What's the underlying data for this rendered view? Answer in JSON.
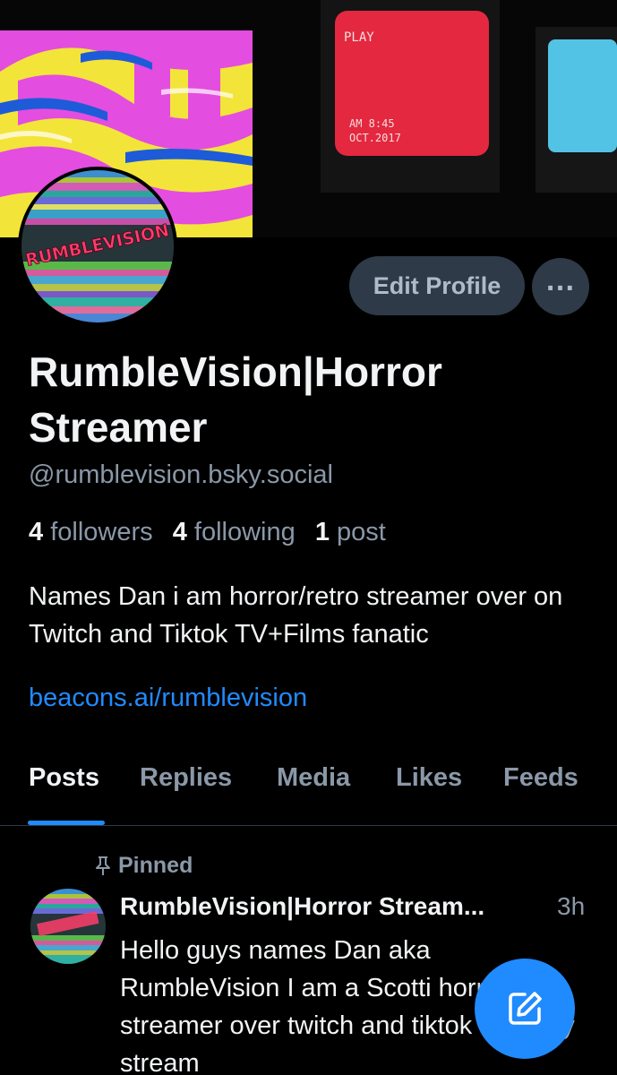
{
  "colors": {
    "background": "#000000",
    "accent": "#208bfe",
    "muted_text": "#8a98a8",
    "button_bg": "#2e3a47"
  },
  "banner": {
    "tv_overlay_top": "PLAY",
    "tv_overlay_bottom_1": "AM 8:45",
    "tv_overlay_bottom_2": "OCT.2017"
  },
  "avatar": {
    "logo_text": "RUMBLEVISION"
  },
  "actions": {
    "edit_profile_label": "Edit Profile",
    "more_icon": "more-horizontal-icon"
  },
  "profile": {
    "display_name": "RumbleVision|Horror Streamer",
    "handle": "@rumblevision.bsky.social",
    "followers_count": "4",
    "followers_label": "followers",
    "following_count": "4",
    "following_label": "following",
    "posts_count": "1",
    "posts_label": "post",
    "bio": "Names Dan i am horror/retro streamer over on Twitch and Tiktok TV+Films fanatic",
    "bio_link": "beacons.ai/rumblevision"
  },
  "tabs": [
    {
      "label": "Posts",
      "active": true
    },
    {
      "label": "Replies",
      "active": false
    },
    {
      "label": "Media",
      "active": false
    },
    {
      "label": "Likes",
      "active": false
    },
    {
      "label": "Feeds",
      "active": false
    }
  ],
  "post": {
    "pinned_label": "Pinned",
    "author": "RumbleVision|Horror Stream...",
    "time": "3h",
    "text": "Hello guys names Dan aka RumbleVision I am a Scotti horror/retro streamer over twitch and tiktok I usually stream"
  },
  "compose": {
    "icon": "compose-icon"
  }
}
